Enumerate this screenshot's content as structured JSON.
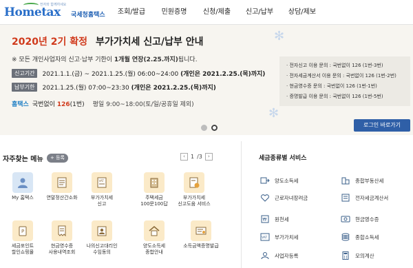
{
  "header": {
    "logo_text": "Hometax",
    "logo_tagline": "전자와 함께하세요",
    "logo_subtitle": "국세청홈택스",
    "nav": [
      "조회/발급",
      "민원증명",
      "신청/제출",
      "신고/납부",
      "상담/제보"
    ]
  },
  "banner": {
    "headline_red": "2020년 2기 확정",
    "headline_dark": "부가가치세 신고/납부 안내",
    "note_prefix": "※ 모든 개인사업자의 신고·납부 기한이 ",
    "note_bold": "1개월 연장(2.25.까지)",
    "note_suffix": "됩니다.",
    "period_label": "신고기간",
    "period_text": "2021.1.1.(금) ~ 2021.1.25.(월) 06:00~24:00 ",
    "period_bold": "(개인은 2021.2.25.(목)까지)",
    "deadline_label": "납부기한",
    "deadline_text": "2021.1.25.(월) 07:00~23:30 ",
    "deadline_bold": "(개인은 2021.2.25.(목)까지)",
    "phone_brand": "홈택스",
    "phone_text": "국번없이 ",
    "phone_num": "126",
    "phone_ext": "(1번)",
    "hours": "평일 9:00~18:00(토/일/공휴일 제외)",
    "login_button": "로그인 바로가기",
    "side_info": [
      "전자신고 이용 문의 : 국번없이 126 (1번-3번)",
      "전자세금계산서 이용 문의 : 국번없이 126 (1번-2번)",
      "현금영수증 문의 : 국번없이 126 (1번-1번)",
      "증명발급 이용 문의 : 국번없이 126 (1번-5번)"
    ]
  },
  "favorites": {
    "title": "자주찾는 메뉴",
    "add_label": "+ 등록",
    "page_current": "1",
    "page_total": "/3",
    "tiles": [
      {
        "label1": "My 홈택스",
        "label2": "",
        "icon": "person-icon"
      },
      {
        "label1": "연말정산간소화",
        "label2": "",
        "icon": "document-icon"
      },
      {
        "label1": "부가가치세",
        "label2": "신고",
        "icon": "vat-icon"
      },
      {
        "label1": "주택세금",
        "label2": "100문100답",
        "icon": "building-icon"
      },
      {
        "label1": "부가가치세",
        "label2": "신고도움 서비스",
        "icon": "help-doc-icon"
      },
      {
        "label1": "세금포인트",
        "label2": "할인쇼핑몰",
        "icon": "point-icon"
      },
      {
        "label1": "현금영수증",
        "label2": "사용내역조회",
        "icon": "receipt-icon"
      },
      {
        "label1": "나의신고대리인",
        "label2": "수임동의",
        "icon": "agent-icon"
      },
      {
        "label1": "양도소득세",
        "label2": "종합안내",
        "icon": "house-icon"
      },
      {
        "label1": "소득금액증명발급",
        "label2": "",
        "icon": "certificate-icon"
      }
    ]
  },
  "tax_services": {
    "title": "세금종류별 서비스",
    "items": [
      {
        "label": "양도소득세",
        "icon": "transfer-tax-icon"
      },
      {
        "label": "종합부동산세",
        "icon": "real-estate-icon"
      },
      {
        "label": "근로자녀장려금",
        "icon": "heart-icon"
      },
      {
        "label": "전자세금계산서",
        "icon": "e-invoice-icon"
      },
      {
        "label": "원천세",
        "icon": "withholding-icon"
      },
      {
        "label": "현금영수증",
        "icon": "cash-receipt-icon"
      },
      {
        "label": "부가가치세",
        "icon": "vat-small-icon"
      },
      {
        "label": "종합소득세",
        "icon": "income-tax-icon"
      },
      {
        "label": "사업자등록",
        "icon": "business-reg-icon"
      },
      {
        "label": "모의계산",
        "icon": "calculator-icon"
      }
    ]
  },
  "colors": {
    "accent_red": "#d03a1c",
    "brand_blue": "#2a6fc9",
    "login_blue": "#2f5fa7",
    "tile_bg": "#fbeac8"
  }
}
